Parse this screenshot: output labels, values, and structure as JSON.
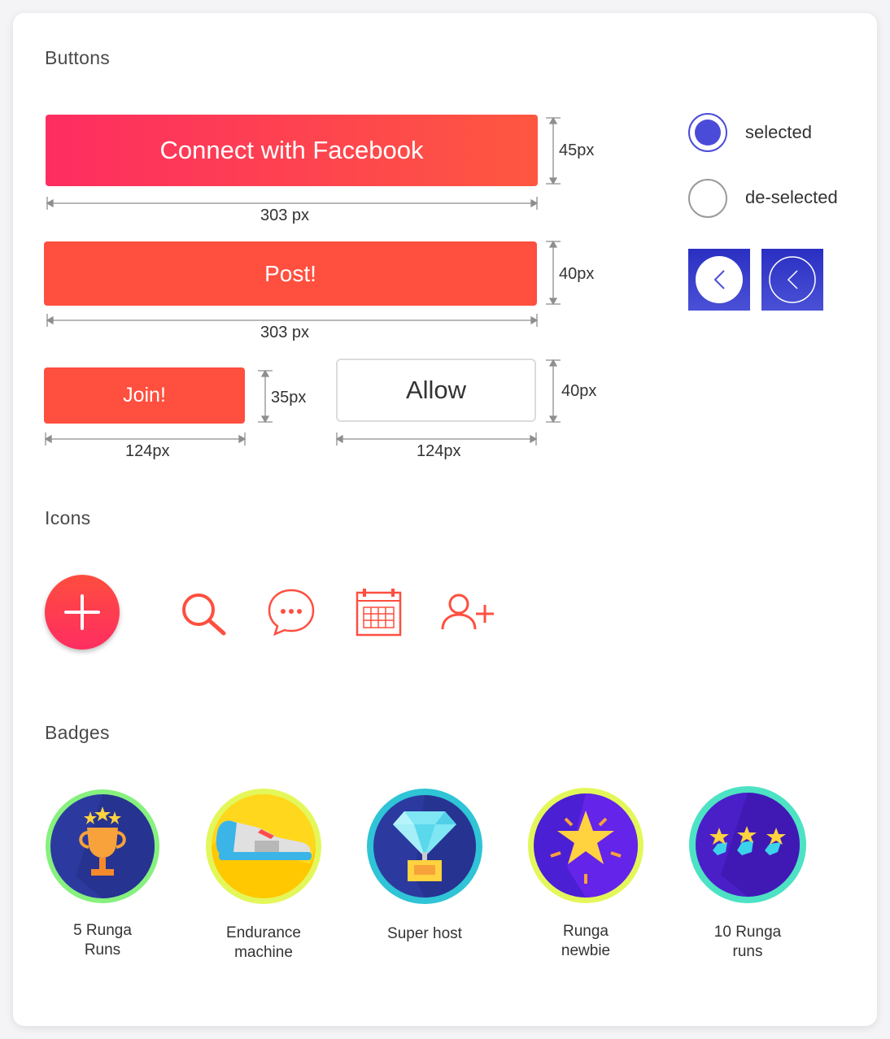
{
  "sections": {
    "buttons_title": "Buttons",
    "icons_title": "Icons",
    "badges_title": "Badges"
  },
  "buttons": {
    "facebook": {
      "label": "Connect with Facebook",
      "height_label": "45px",
      "width_label": "303 px"
    },
    "post": {
      "label": "Post!",
      "height_label": "40px",
      "width_label": "303 px"
    },
    "join": {
      "label": "Join!",
      "height_label": "35px",
      "width_label": "124px"
    },
    "allow": {
      "label": "Allow",
      "height_label": "40px",
      "width_label": "124px"
    }
  },
  "radios": {
    "selected_label": "selected",
    "deselected_label": "de-selected"
  },
  "icons": [
    "add-icon",
    "search-icon",
    "chat-icon",
    "calendar-icon",
    "add-user-icon"
  ],
  "badges": [
    {
      "line1": "5 Runga",
      "line2": "Runs",
      "icon": "trophy-icon"
    },
    {
      "line1": "Endurance",
      "line2": "machine",
      "icon": "shoe-icon"
    },
    {
      "line1": "Super host",
      "line2": "",
      "icon": "diamond-icon"
    },
    {
      "line1": "Runga",
      "line2": "newbie",
      "icon": "star-icon"
    },
    {
      "line1": "10 Runga",
      "line2": "runs",
      "icon": "stars-icon"
    }
  ],
  "colors": {
    "primary": "#fe4f3f",
    "gradient_start": "#fe2d61",
    "accent_blue": "#4b4bd9"
  }
}
